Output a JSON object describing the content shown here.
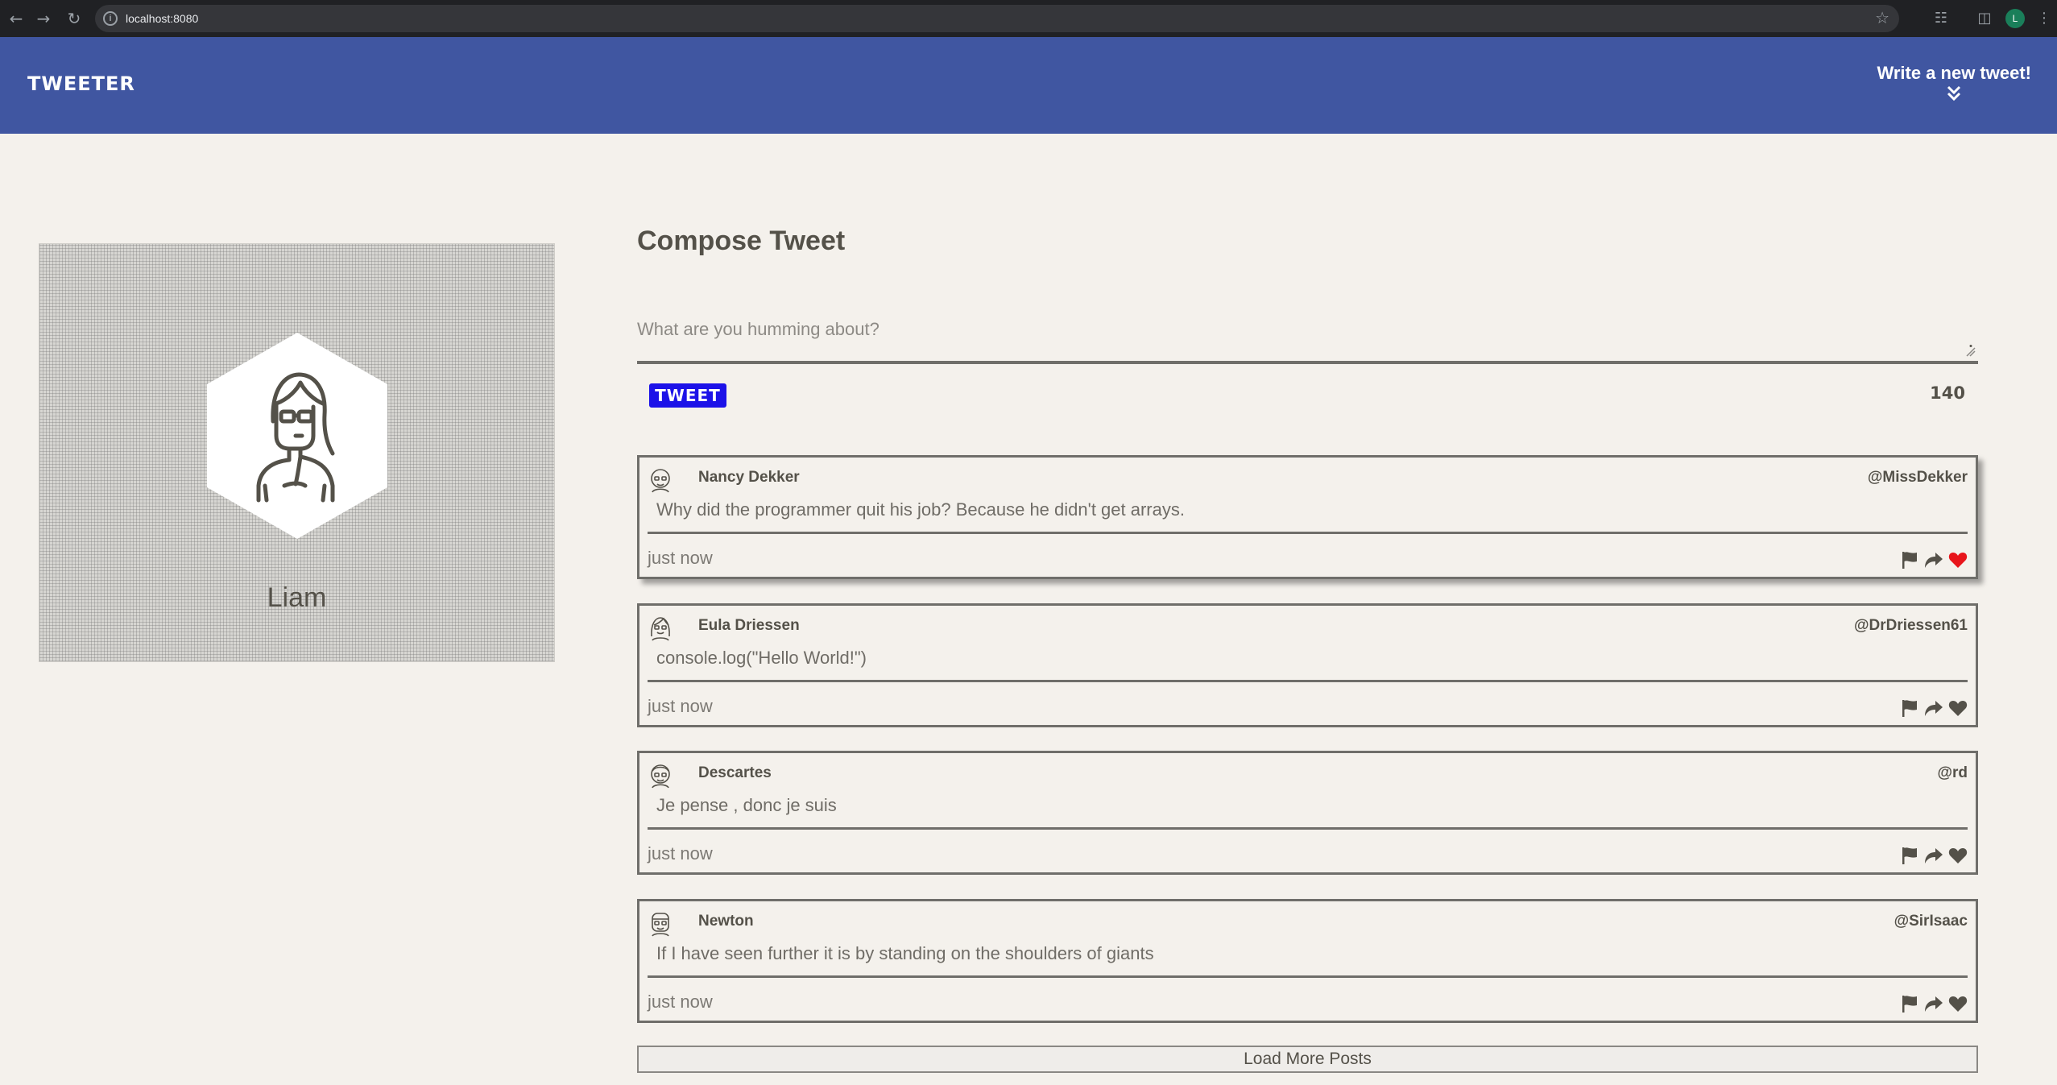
{
  "browser": {
    "url": "localhost:8080",
    "profile_initial": "L"
  },
  "header": {
    "brand": "TWEETER",
    "write_new": "Write a new tweet!"
  },
  "profile": {
    "name": "Liam"
  },
  "compose": {
    "title": "Compose Tweet",
    "placeholder": "What are you humming about?",
    "button_label": "TWEET",
    "counter": "140"
  },
  "tweets": [
    {
      "name": "Nancy Dekker",
      "handle": "@MissDekker",
      "content": "Why did the programmer quit his job? Because he didn't get arrays.",
      "time": "just now",
      "liked": true
    },
    {
      "name": "Eula Driessen",
      "handle": "@DrDriessen61",
      "content": "console.log(\"Hello World!\")",
      "time": "just now",
      "liked": false
    },
    {
      "name": "Descartes",
      "handle": "@rd",
      "content": "Je pense , donc je suis",
      "time": "just now",
      "liked": false
    },
    {
      "name": "Newton",
      "handle": "@SirIsaac",
      "content": "If I have seen further it is by standing on the shoulders of giants",
      "time": "just now",
      "liked": false
    }
  ],
  "load_more": "Load More Posts",
  "colors": {
    "header_bg": "#4056a1",
    "page_bg": "#f4f1ec",
    "text": "#545149",
    "tweet_button": "#1c12e8",
    "like_active": "#e8151b"
  },
  "icons": [
    "back-icon",
    "forward-icon",
    "reload-icon",
    "site-info-icon",
    "bookmark-star-icon",
    "extensions-icon",
    "side-panel-icon",
    "menu-icon",
    "double-chevron-down-icon",
    "flag-icon",
    "retweet-icon",
    "heart-icon",
    "avatar-icon"
  ]
}
